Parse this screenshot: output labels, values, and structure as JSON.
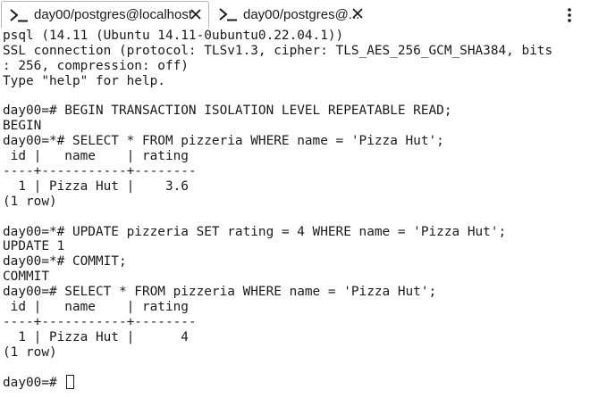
{
  "tabs": [
    {
      "label": "day00/postgres@localhost",
      "icon": "terminal-icon",
      "close_icon": "close-icon",
      "active": true
    },
    {
      "label": "day00/postgres@...",
      "icon": "terminal-icon",
      "close_icon": "close-icon",
      "active": false
    }
  ],
  "menu_icon": "more-vert-icon",
  "terminal": {
    "lines": [
      "psql (14.11 (Ubuntu 14.11-0ubuntu0.22.04.1))",
      "SSL connection (protocol: TLSv1.3, cipher: TLS_AES_256_GCM_SHA384, bits",
      ": 256, compression: off)",
      "Type \"help\" for help.",
      "",
      "day00=# BEGIN TRANSACTION ISOLATION LEVEL REPEATABLE READ;",
      "BEGIN",
      "day00=*# SELECT * FROM pizzeria WHERE name = 'Pizza Hut';",
      " id |   name    | rating",
      "----+-----------+--------",
      "  1 | Pizza Hut |    3.6",
      "(1 row)",
      "",
      "day00=*# UPDATE pizzeria SET rating = 4 WHERE name = 'Pizza Hut';",
      "UPDATE 1",
      "day00=*# COMMIT;",
      "COMMIT",
      "day00=# SELECT * FROM pizzeria WHERE name = 'Pizza Hut';",
      " id |   name    | rating",
      "----+-----------+--------",
      "  1 | Pizza Hut |      4",
      "(1 row)",
      ""
    ],
    "prompt": "day00=# ",
    "cursor_icon": "text-cursor-icon"
  }
}
